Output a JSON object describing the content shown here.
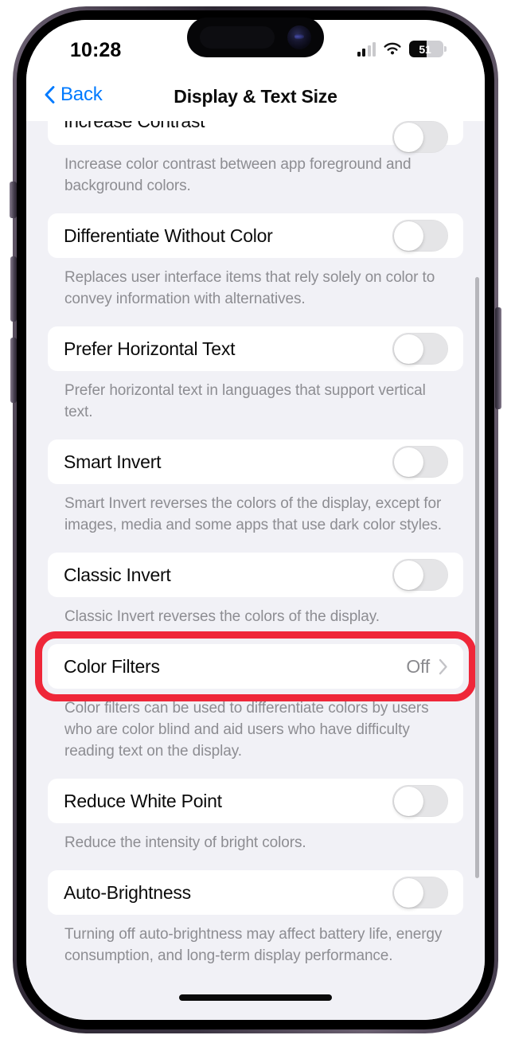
{
  "status_bar": {
    "time": "10:28",
    "cellular_icon": "cellular-bars-icon",
    "cellular_bars_filled": 2,
    "cellular_bars_total": 4,
    "wifi_icon": "wifi-icon",
    "battery_icon": "battery-icon",
    "battery_level": "51",
    "battery_percent": 51
  },
  "nav_bar": {
    "back_label": "Back",
    "back_icon": "chevron-left-icon",
    "title": "Display & Text Size"
  },
  "colors": {
    "accent_blue": "#007aff",
    "annotation_red": "#ef2739",
    "page_background": "#f1f1f6",
    "card_background": "#ffffff",
    "footnote_text": "#8d8d92",
    "value_text": "#8a8a8e"
  },
  "settings": [
    {
      "label": "Increase Contrast",
      "type": "toggle",
      "state": "off",
      "clipped_top": true,
      "footnote": "Increase color contrast between app foreground and background colors."
    },
    {
      "label": "Differentiate Without Color",
      "type": "toggle",
      "state": "off",
      "footnote": "Replaces user interface items that rely solely on color to convey information with alternatives."
    },
    {
      "label": "Prefer Horizontal Text",
      "type": "toggle",
      "state": "off",
      "footnote": "Prefer horizontal text in languages that support vertical text."
    },
    {
      "label": "Smart Invert",
      "type": "toggle",
      "state": "off",
      "footnote": "Smart Invert reverses the colors of the display, except for images, media and some apps that use dark color styles."
    },
    {
      "label": "Classic Invert",
      "type": "toggle",
      "state": "off",
      "footnote": "Classic Invert reverses the colors of the display."
    },
    {
      "label": "Color Filters",
      "type": "disclosure",
      "value": "Off",
      "disclosure_icon": "chevron-right-icon",
      "highlighted": true,
      "footnote": "Color filters can be used to differentiate colors by users who are color blind and aid users who have difficulty reading text on the display."
    },
    {
      "label": "Reduce White Point",
      "type": "toggle",
      "state": "off",
      "footnote": "Reduce the intensity of bright colors."
    },
    {
      "label": "Auto-Brightness",
      "type": "toggle",
      "state": "off",
      "footnote": "Turning off auto-brightness may affect battery life, energy consumption, and long-term display performance."
    }
  ],
  "device": {
    "dynamic_island": "dynamic-island",
    "camera_icon": "front-camera-icon",
    "home_indicator": "home-indicator",
    "mute_switch": "mute-switch-button",
    "volume_up": "volume-up-button",
    "volume_down": "volume-down-button",
    "power_button": "power-button",
    "scrollbar": "vertical-scrollbar"
  }
}
